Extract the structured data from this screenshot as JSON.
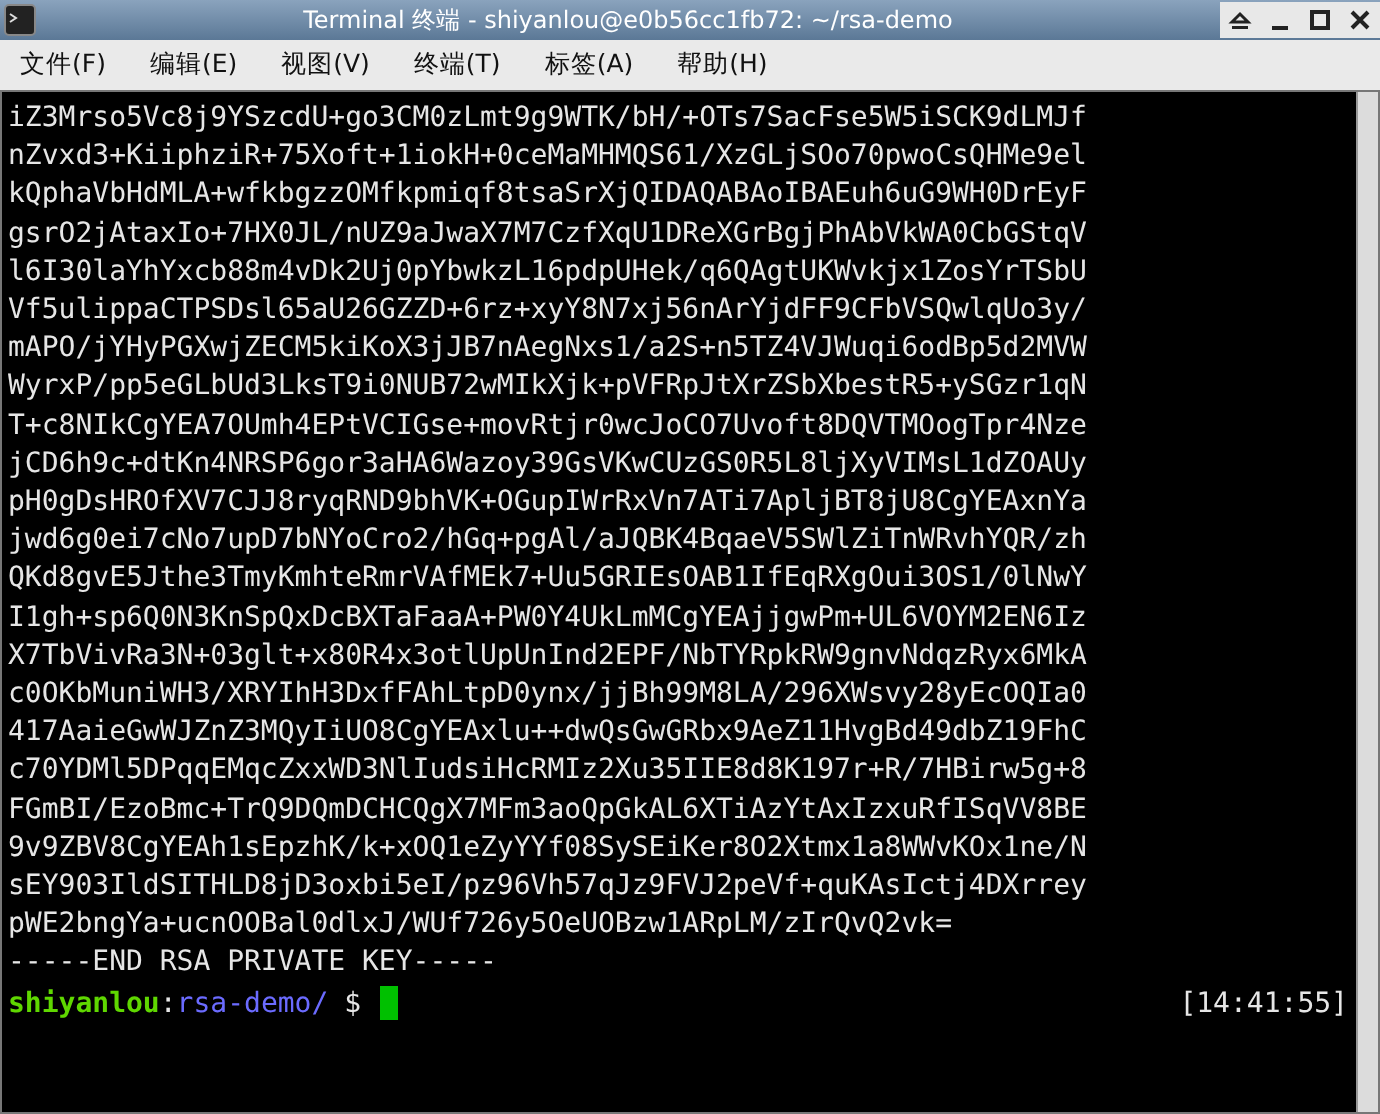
{
  "window": {
    "title": "Terminal 终端 - shiyanlou@e0b56cc1fb72: ~/rsa-demo"
  },
  "menu": [
    {
      "label": "文件(F)"
    },
    {
      "label": "编辑(E)"
    },
    {
      "label": "视图(V)"
    },
    {
      "label": "终端(T)"
    },
    {
      "label": "标签(A)"
    },
    {
      "label": "帮助(H)"
    }
  ],
  "terminal": {
    "lines": [
      "iZ3Mrso5Vc8j9YSzcdU+go3CM0zLmt9g9WTK/bH/+OTs7SacFse5W5iSCK9dLMJf",
      "nZvxd3+KiiphziR+75Xoft+1iokH+0ceMaMHMQS61/XzGLjSOo70pwoCsQHMe9el",
      "kQphaVbHdMLA+wfkbgzzOMfkpmiqf8tsaSrXjQIDAQABAoIBAEuh6uG9WH0DrEyF",
      "gsrO2jAtaxIo+7HX0JL/nUZ9aJwaX7M7CzfXqU1DReXGrBgjPhAbVkWA0CbGStqV",
      "l6I30laYhYxcb88m4vDk2Uj0pYbwkzL16pdpUHek/q6QAgtUKWvkjx1ZosYrTSbU",
      "Vf5ulippaCTPSDsl65aU26GZZD+6rz+xyY8N7xj56nArYjdFF9CFbVSQwlqUo3y/",
      "mAPO/jYHyPGXwjZECM5kiKoX3jJB7nAegNxs1/a2S+n5TZ4VJWuqi6odBp5d2MVW",
      "WyrxP/pp5eGLbUd3LksT9i0NUB72wMIkXjk+pVFRpJtXrZSbXbestR5+ySGzr1qN",
      "T+c8NIkCgYEA7OUmh4EPtVCIGse+movRtjr0wcJoCO7Uvoft8DQVTMOogTpr4Nze",
      "jCD6h9c+dtKn4NRSP6gor3aHA6Wazoy39GsVKwCUzGS0R5L8ljXyVIMsL1dZOAUy",
      "pH0gDsHROfXV7CJJ8ryqRND9bhVK+OGupIWrRxVn7ATi7ApljBT8jU8CgYEAxnYa",
      "jwd6g0ei7cNo7upD7bNYoCro2/hGq+pgAl/aJQBK4BqaeV5SWlZiTnWRvhYQR/zh",
      "QKd8gvE5Jthe3TmyKmhteRmrVAfMEk7+Uu5GRIEsOAB1IfEqRXgOui3OS1/0lNwY",
      "I1gh+sp6Q0N3KnSpQxDcBXTaFaaA+PW0Y4UkLmMCgYEAjjgwPm+UL6VOYM2EN6Iz",
      "X7TbVivRa3N+03glt+x80R4x3otlUpUnInd2EPF/NbTYRpkRW9gnvNdqzRyx6MkA",
      "c0OKbMuniWH3/XRYIhH3DxfFAhLtpD0ynx/jjBh99M8LA/296XWsvy28yEcOQIa0",
      "417AaieGwWJZnZ3MQyIiUO8CgYEAxlu++dwQsGwGRbx9AeZ11HvgBd49dbZ19FhC",
      "c70YDMl5DPqqEMqcZxxWD3NlIudsiHcRMIz2Xu35IIE8d8K197r+R/7HBirw5g+8",
      "FGmBI/EzoBmc+TrQ9DQmDCHCQgX7MFm3aoQpGkAL6XTiAzYtAxIzxuRfISqVV8BE",
      "9v9ZBV8CgYEAh1sEpzhK/k+xOQ1eZyYYf08SySEiKer8O2Xtmx1a8WWvKOx1ne/N",
      "sEY903IldSITHLD8jD3oxbi5eI/pz96Vh57qJz9FVJ2peVf+quKAsIctj4DXrrey",
      "pWE2bngYa+ucnOOBal0dlxJ/WUf726y5OeUOBzw1ARpLM/zIrQvQ2vk=",
      "-----END RSA PRIVATE KEY-----"
    ],
    "prompt": {
      "user": "shiyanlou",
      "separator": ":",
      "path": "rsa-demo/",
      "symbol": "$"
    },
    "clock": "[14:41:55]"
  }
}
